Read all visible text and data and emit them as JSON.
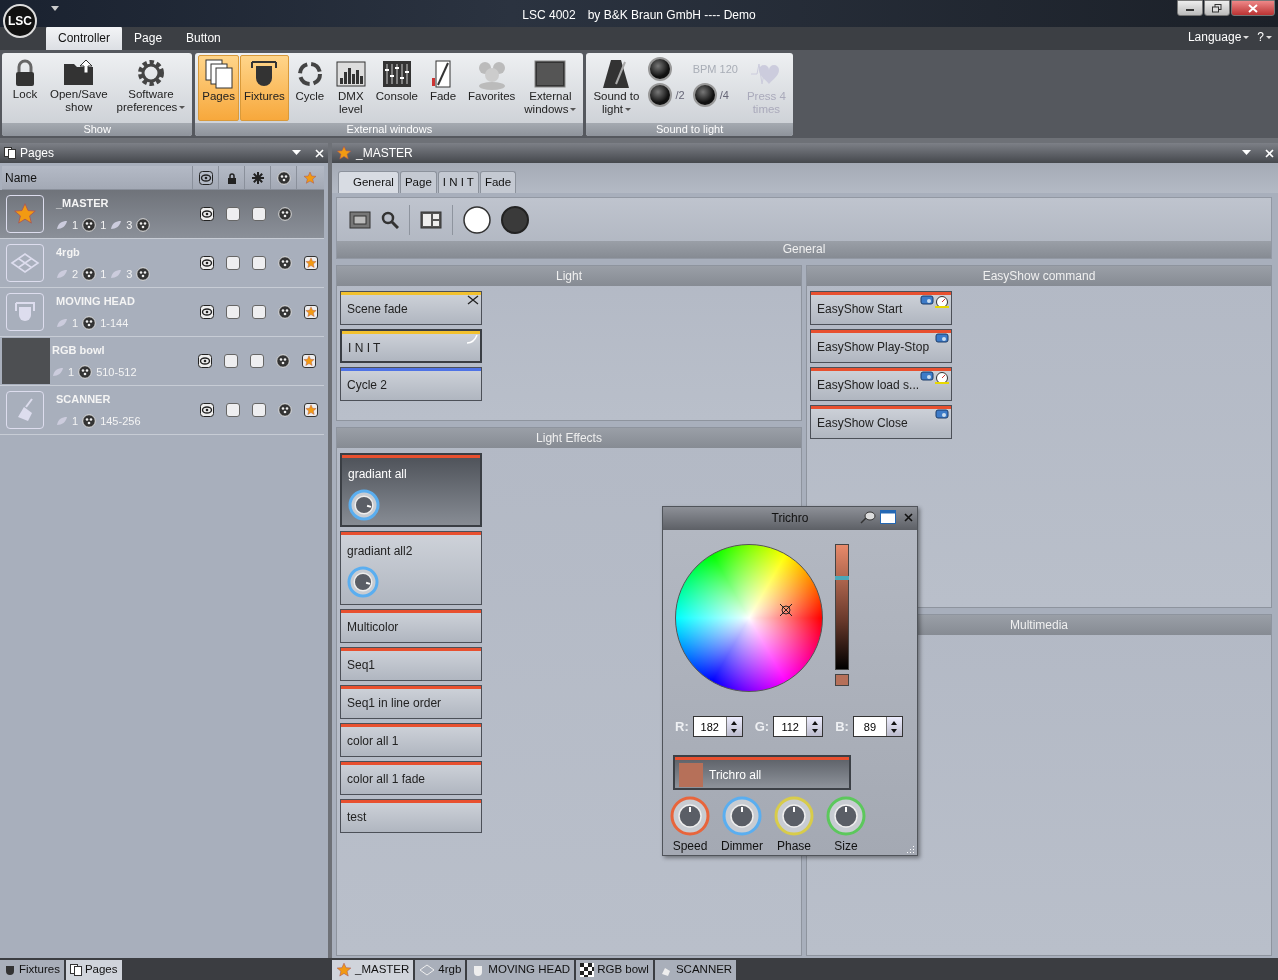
{
  "window": {
    "logo": "LSC",
    "title": "LSC 4002",
    "subtitle": "by B&K Braun GmbH ---- Demo"
  },
  "ribbon_tabs": [
    {
      "label": "Controller",
      "selected": true
    },
    {
      "label": "Page",
      "selected": false
    },
    {
      "label": "Button",
      "selected": false
    }
  ],
  "language": "Language",
  "help": "?",
  "ribbon_groups": [
    {
      "title": "Show",
      "items": [
        {
          "kind": "large",
          "label": [
            "Lock"
          ],
          "active": false,
          "dropdown": false,
          "disabled": false
        },
        {
          "kind": "large",
          "label": [
            "Open/Save",
            "show"
          ],
          "active": false,
          "dropdown": false,
          "disabled": false
        },
        {
          "kind": "large",
          "label": [
            "Software",
            "preferences"
          ],
          "active": false,
          "dropdown": true,
          "disabled": false
        }
      ]
    },
    {
      "title": "External windows",
      "items": [
        {
          "kind": "large",
          "label": [
            "Pages"
          ],
          "active": true,
          "dropdown": false,
          "disabled": false
        },
        {
          "kind": "large",
          "label": [
            "Fixtures"
          ],
          "active": true,
          "dropdown": false,
          "disabled": false
        },
        {
          "kind": "large",
          "label": [
            "Cycle"
          ],
          "active": false,
          "dropdown": false,
          "disabled": false
        },
        {
          "kind": "large",
          "label": [
            "DMX",
            "level"
          ],
          "active": false,
          "dropdown": false,
          "disabled": false
        },
        {
          "kind": "large",
          "label": [
            "Console"
          ],
          "active": false,
          "dropdown": false,
          "disabled": false
        },
        {
          "kind": "large",
          "label": [
            "Fade"
          ],
          "active": false,
          "dropdown": false,
          "disabled": false
        },
        {
          "kind": "large",
          "label": [
            "Favorites"
          ],
          "active": false,
          "dropdown": false,
          "disabled": false
        },
        {
          "kind": "large",
          "label": [
            "External",
            "windows"
          ],
          "active": false,
          "dropdown": true,
          "disabled": false
        }
      ]
    },
    {
      "title": "Sound to light",
      "items": [
        {
          "kind": "large",
          "label": [
            "Sound to",
            "light"
          ],
          "active": false,
          "dropdown": true,
          "disabled": false
        },
        {
          "kind": "tap_grid",
          "bpm": "BPM 120",
          "divisors": [
            "/2",
            "/4"
          ]
        },
        {
          "kind": "large",
          "label": [
            "Press 4",
            "times"
          ],
          "active": false,
          "dropdown": false,
          "disabled": true
        }
      ]
    }
  ],
  "pages_panel": {
    "title": "Pages",
    "columns": [
      "Name"
    ],
    "rows": [
      {
        "name": "_MASTER",
        "selected": true,
        "stats": [
          "1",
          "1",
          "3"
        ],
        "truncated": true,
        "lock_checked": false,
        "column_4_checked": false,
        "favorite": false
      },
      {
        "name": "4rgb",
        "selected": false,
        "stats": [
          "2",
          "1",
          "3"
        ],
        "truncated": true,
        "lock_checked": false,
        "column_4_checked": false,
        "favorite": true
      },
      {
        "name": "MOVING HEAD",
        "selected": false,
        "stats": [
          "1",
          "1-144"
        ],
        "truncated": false,
        "lock_checked": false,
        "column_4_checked": false,
        "favorite": true
      },
      {
        "name": "RGB bowl",
        "selected": false,
        "stats": [
          "1",
          "510-512"
        ],
        "truncated": false,
        "lock_checked": false,
        "column_4_checked": false,
        "favorite": true
      },
      {
        "name": "SCANNER",
        "selected": false,
        "stats": [
          "1",
          "145-256"
        ],
        "truncated": false,
        "lock_checked": false,
        "column_4_checked": false,
        "favorite": true
      }
    ]
  },
  "document": {
    "title": "_MASTER",
    "tabs": [
      {
        "label": "General",
        "selected": true
      },
      {
        "label": "Page",
        "selected": false
      },
      {
        "label": "I N I T",
        "selected": false
      },
      {
        "label": "Fade",
        "selected": false
      }
    ],
    "toolbar_title": "General",
    "light": {
      "title": "Light",
      "buttons": [
        {
          "label": "Scene fade",
          "color": "#f2c12e",
          "selected": false
        },
        {
          "label": "I N I T",
          "color": "#f2c12e",
          "selected": true
        },
        {
          "label": "Cycle 2",
          "color": "#4f73e6",
          "selected": false
        }
      ]
    },
    "effects": {
      "title": "Light Effects",
      "buttons": [
        {
          "label": "gradiant all",
          "color": "#e8502f",
          "selected": true,
          "kind": "knob"
        },
        {
          "label": "gradiant all2",
          "color": "#e8502f",
          "selected": false,
          "kind": "knob"
        },
        {
          "label": "Multicolor",
          "color": "#e8502f",
          "selected": false,
          "kind": "plain"
        },
        {
          "label": "Seq1",
          "color": "#e8502f",
          "selected": false,
          "kind": "plain"
        },
        {
          "label": "Seq1 in line order",
          "color": "#e8502f",
          "selected": false,
          "kind": "plain"
        },
        {
          "label": "color all 1",
          "color": "#e8502f",
          "selected": false,
          "kind": "plain"
        },
        {
          "label": "color all 1 fade",
          "color": "#e8502f",
          "selected": false,
          "kind": "plain"
        },
        {
          "label": "test",
          "color": "#e8502f",
          "selected": false,
          "kind": "plain"
        }
      ]
    },
    "easyshow": {
      "title": "EasyShow command",
      "buttons": [
        {
          "label": "EasyShow Start",
          "color": "#e8502f",
          "kind": "timed"
        },
        {
          "label": "EasyShow Play-Stop",
          "color": "#e8502f",
          "kind": "plain"
        },
        {
          "label": "EasyShow load s...",
          "color": "#e8502f",
          "kind": "timed"
        },
        {
          "label": "EasyShow Close",
          "color": "#e8502f",
          "kind": "plain"
        }
      ]
    },
    "multimedia": {
      "title": "Multimedia"
    }
  },
  "trichro": {
    "title": "Trichro",
    "level": 0.74,
    "fields": [
      {
        "label": "R:",
        "value": "182"
      },
      {
        "label": "G:",
        "value": "112"
      },
      {
        "label": "B:",
        "value": "89"
      }
    ],
    "button": {
      "label": "Trichro all",
      "color": "#e8502f"
    },
    "knobs": [
      {
        "label": "Speed",
        "color": "#e8653c"
      },
      {
        "label": "Dimmer",
        "color": "#5aaef0"
      },
      {
        "label": "Phase",
        "color": "#d8cc4a"
      },
      {
        "label": "Size",
        "color": "#5cc85c"
      }
    ]
  },
  "bottom_left_tabs": [
    {
      "label": "Fixtures",
      "selected": false
    },
    {
      "label": "Pages",
      "selected": true
    }
  ],
  "bottom_right_tabs": [
    {
      "label": "_MASTER",
      "selected": true
    },
    {
      "label": "4rgb",
      "selected": false
    },
    {
      "label": "MOVING HEAD",
      "selected": false
    },
    {
      "label": "RGB bowl",
      "selected": false
    },
    {
      "label": "SCANNER",
      "selected": false
    }
  ]
}
